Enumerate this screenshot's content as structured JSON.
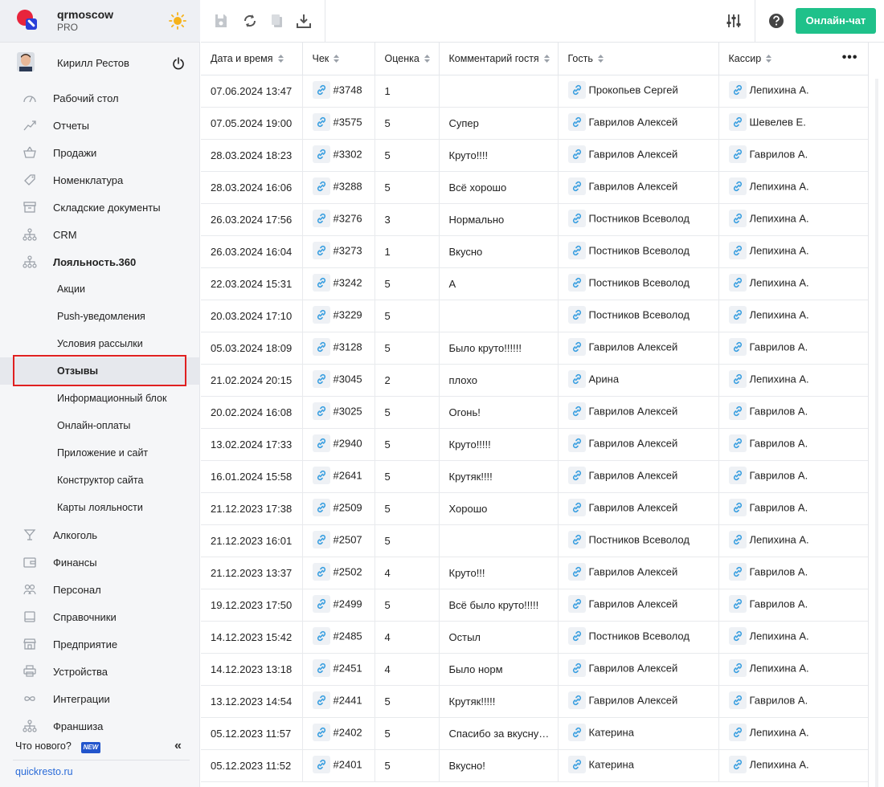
{
  "brand": {
    "name": "qrmoscow",
    "plan": "PRO"
  },
  "user": {
    "name": "Кирилл Рестов"
  },
  "nav": [
    {
      "label": "Рабочий стол",
      "icon": "dashboard-icon",
      "kind": "main"
    },
    {
      "label": "Отчеты",
      "icon": "chart-icon",
      "kind": "main"
    },
    {
      "label": "Продажи",
      "icon": "basket-icon",
      "kind": "main"
    },
    {
      "label": "Номенклатура",
      "icon": "tag-icon",
      "kind": "main"
    },
    {
      "label": "Складские документы",
      "icon": "archive-icon",
      "kind": "main"
    },
    {
      "label": "CRM",
      "icon": "hierarchy-icon",
      "kind": "main"
    },
    {
      "label": "Лояльность.360",
      "icon": "hierarchy-icon",
      "kind": "bold"
    },
    {
      "label": "Акции",
      "kind": "sub"
    },
    {
      "label": "Push-уведомления",
      "kind": "sub"
    },
    {
      "label": "Условия рассылки",
      "kind": "sub"
    },
    {
      "label": "Отзывы",
      "kind": "active"
    },
    {
      "label": "Информационный блок",
      "kind": "sub"
    },
    {
      "label": "Онлайн-оплаты",
      "kind": "sub"
    },
    {
      "label": "Приложение и сайт",
      "kind": "sub"
    },
    {
      "label": "Конструктор сайта",
      "kind": "sub"
    },
    {
      "label": "Карты лояльности",
      "kind": "sub"
    },
    {
      "label": "Алкоголь",
      "icon": "glass-icon",
      "kind": "main"
    },
    {
      "label": "Финансы",
      "icon": "wallet-icon",
      "kind": "main"
    },
    {
      "label": "Персонал",
      "icon": "people-icon",
      "kind": "main"
    },
    {
      "label": "Справочники",
      "icon": "book-icon",
      "kind": "main"
    },
    {
      "label": "Предприятие",
      "icon": "store-icon",
      "kind": "main"
    },
    {
      "label": "Устройства",
      "icon": "printer-icon",
      "kind": "main"
    },
    {
      "label": "Интеграции",
      "icon": "infinity-icon",
      "kind": "main"
    },
    {
      "label": "Франшиза",
      "icon": "hierarchy-icon",
      "kind": "main"
    }
  ],
  "footer": {
    "whats_new": "Что нового?",
    "badge": "NEW",
    "collapse": "«",
    "site": "quickresto.ru"
  },
  "topbar": {
    "chat_label": "Онлайн-чат"
  },
  "table": {
    "headers": [
      "Дата и время",
      "Чек",
      "Оценка",
      "Комментарий гостя",
      "Гость",
      "Кассир"
    ],
    "menu": "•••",
    "rows": [
      [
        "07.06.2024 13:47",
        "#3748",
        "1",
        "",
        "Прокопьев Сергей",
        "Лепихина А."
      ],
      [
        "07.05.2024 19:00",
        "#3575",
        "5",
        "Супер",
        "Гаврилов Алексей",
        "Шевелев Е."
      ],
      [
        "28.03.2024 18:23",
        "#3302",
        "5",
        "Круто!!!!",
        "Гаврилов Алексей",
        "Гаврилов А."
      ],
      [
        "28.03.2024 16:06",
        "#3288",
        "5",
        "Всё хорошо",
        "Гаврилов Алексей",
        "Лепихина А."
      ],
      [
        "26.03.2024 17:56",
        "#3276",
        "3",
        "Нормально",
        "Постников Всеволод",
        "Лепихина А."
      ],
      [
        "26.03.2024 16:04",
        "#3273",
        "1",
        "Вкусно",
        "Постников Всеволод",
        "Лепихина А."
      ],
      [
        "22.03.2024 15:31",
        "#3242",
        "5",
        "А",
        "Постников Всеволод",
        "Лепихина А."
      ],
      [
        "20.03.2024 17:10",
        "#3229",
        "5",
        "",
        "Постников Всеволод",
        "Лепихина А."
      ],
      [
        "05.03.2024 18:09",
        "#3128",
        "5",
        "Было круто!!!!!!",
        "Гаврилов Алексей",
        "Гаврилов А."
      ],
      [
        "21.02.2024 20:15",
        "#3045",
        "2",
        "плохо",
        "Арина",
        "Лепихина А."
      ],
      [
        "20.02.2024 16:08",
        "#3025",
        "5",
        "Огонь!",
        "Гаврилов Алексей",
        "Гаврилов А."
      ],
      [
        "13.02.2024 17:33",
        "#2940",
        "5",
        "Круто!!!!!",
        "Гаврилов Алексей",
        "Гаврилов А."
      ],
      [
        "16.01.2024 15:58",
        "#2641",
        "5",
        "Крутяк!!!!",
        "Гаврилов Алексей",
        "Гаврилов А."
      ],
      [
        "21.12.2023 17:38",
        "#2509",
        "5",
        "Хорошо",
        "Гаврилов Алексей",
        "Гаврилов А."
      ],
      [
        "21.12.2023 16:01",
        "#2507",
        "5",
        "",
        "Постников Всеволод",
        "Лепихина А."
      ],
      [
        "21.12.2023 13:37",
        "#2502",
        "4",
        "Круто!!!",
        "Гаврилов Алексей",
        "Гаврилов А."
      ],
      [
        "19.12.2023 17:50",
        "#2499",
        "5",
        "Всё было круто!!!!!",
        "Гаврилов Алексей",
        "Гаврилов А."
      ],
      [
        "14.12.2023 15:42",
        "#2485",
        "4",
        "Остыл",
        "Постников Всеволод",
        "Лепихина А."
      ],
      [
        "14.12.2023 13:18",
        "#2451",
        "4",
        "Было норм",
        "Гаврилов Алексей",
        "Лепихина А."
      ],
      [
        "13.12.2023 14:54",
        "#2441",
        "5",
        "Крутяк!!!!!",
        "Гаврилов Алексей",
        "Гаврилов А."
      ],
      [
        "05.12.2023 11:57",
        "#2402",
        "5",
        "Спасибо за вкусну…",
        "Катерина",
        "Лепихина А."
      ],
      [
        "05.12.2023 11:52",
        "#2401",
        "5",
        "Вкусно!",
        "Катерина",
        "Лепихина А."
      ]
    ]
  },
  "colors": {
    "accent": "#1fc18a",
    "link": "#2a6bd8",
    "highlight": "#e02020",
    "link_icon": "#3a9fe0"
  }
}
